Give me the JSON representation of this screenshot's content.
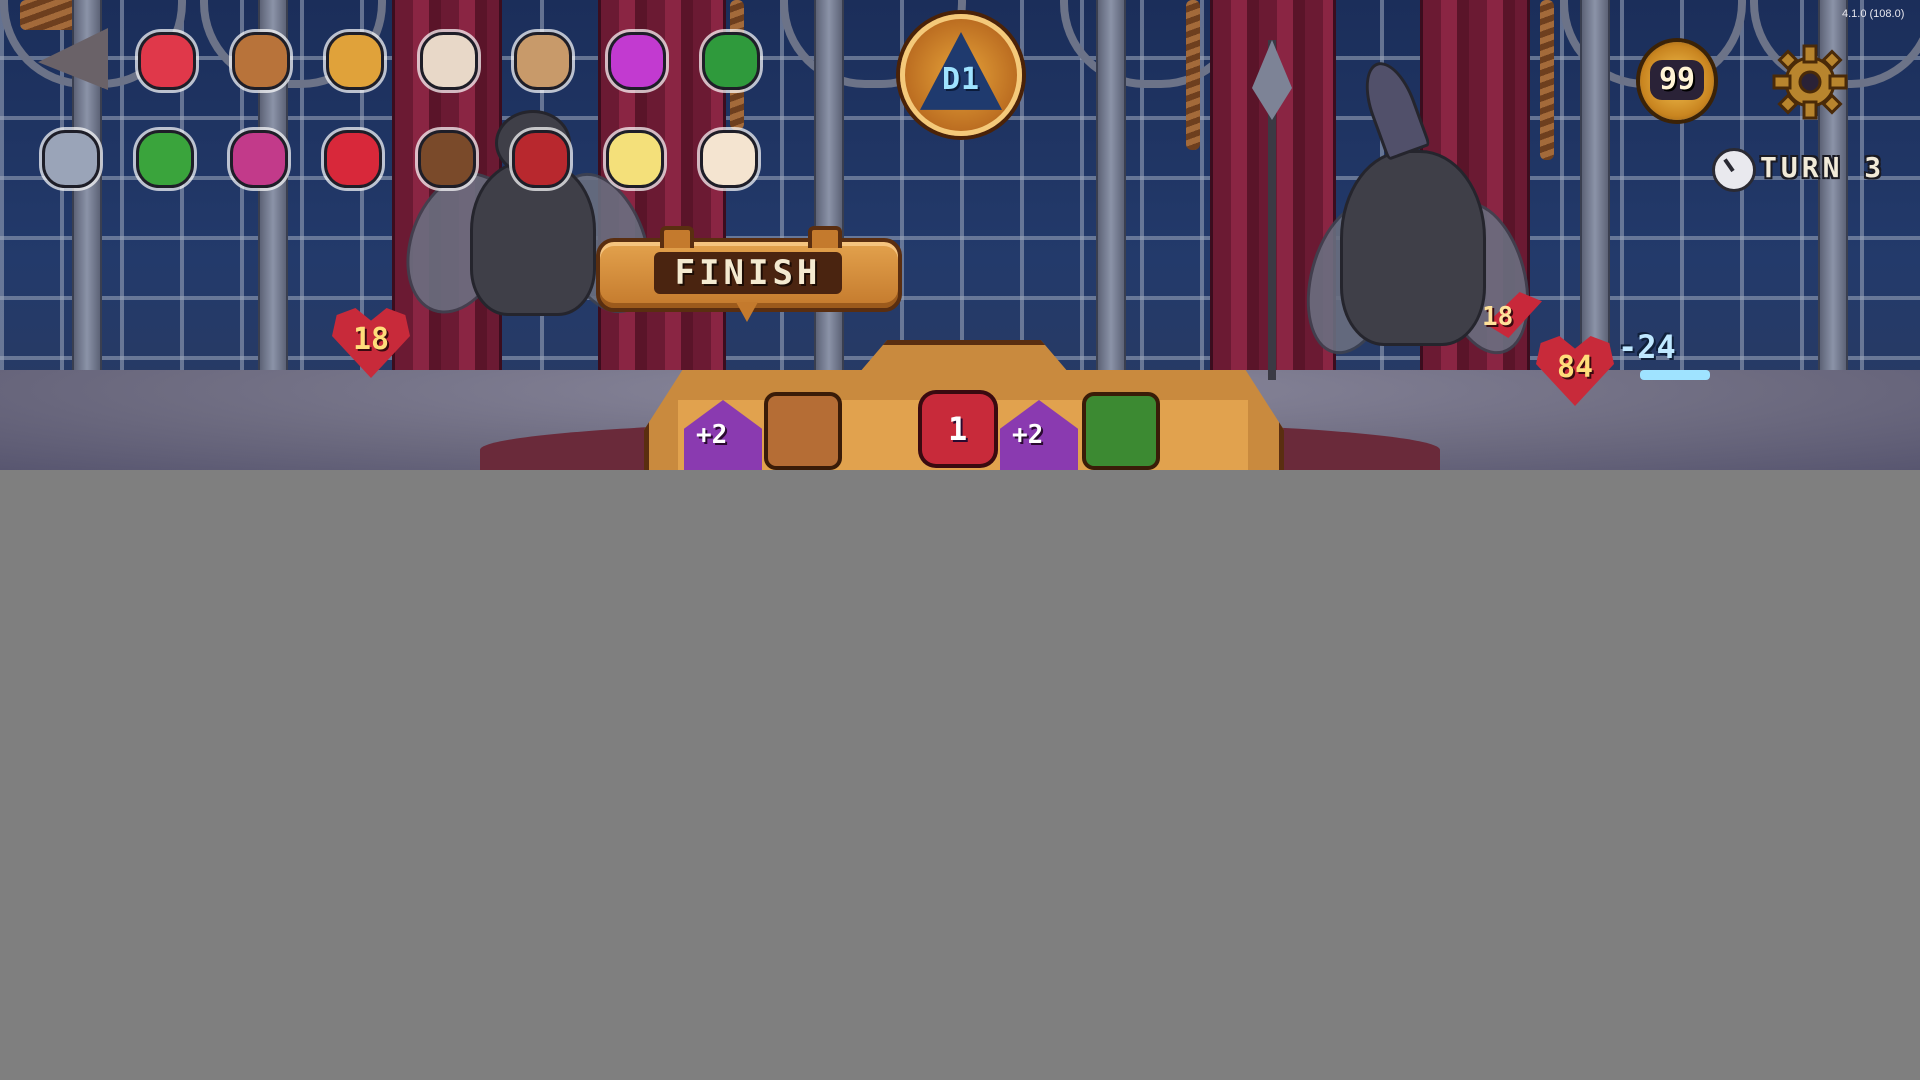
{
  "version": "4.1.0 (108.0)",
  "hud": {
    "dungeon_level": "D1",
    "gold": "99",
    "turn_label": "TURN 3",
    "settings_icon": "gear-icon",
    "turn_icon": "clock-icon"
  },
  "buttons": {
    "finish_label": "FINISH",
    "back_icon": "back-arrow-icon"
  },
  "inventory": {
    "row1": [
      {
        "name": "red-potion-icon",
        "color": "#e0384a"
      },
      {
        "name": "wooden-chair-icon",
        "color": "#b8733a"
      },
      {
        "name": "golden-stone-icon",
        "color": "#e0a23a"
      },
      {
        "name": "bow-tie-icon",
        "color": "#e8d8c8"
      },
      {
        "name": "open-book-icon",
        "color": "#c89a6a"
      },
      {
        "name": "pink-eye-amulet-icon",
        "color": "#c23ad0"
      },
      {
        "name": "green-hat-icon",
        "color": "#2f9a3c"
      }
    ],
    "row2": [
      {
        "name": "metal-cubes-icon",
        "color": "#9aa4b8"
      },
      {
        "name": "green-bush-icon",
        "color": "#3aa43c"
      },
      {
        "name": "flower-sprig-icon",
        "color": "#c23a8a"
      },
      {
        "name": "red-feather-icon",
        "color": "#d8283a"
      },
      {
        "name": "leather-pouch-icon",
        "color": "#7a4a2a"
      },
      {
        "name": "red-witch-hat-icon",
        "color": "#b8282e"
      },
      {
        "name": "light-bulb-icon",
        "color": "#f4e07a"
      },
      {
        "name": "expand-arrow-icon",
        "color": "#f4e4d0"
      }
    ]
  },
  "player": {
    "health": "18"
  },
  "enemy": {
    "attack": "18",
    "health": "84",
    "shield": "-24"
  },
  "board": {
    "left_die": "+2",
    "center_die": "1",
    "right_die": "+2"
  }
}
